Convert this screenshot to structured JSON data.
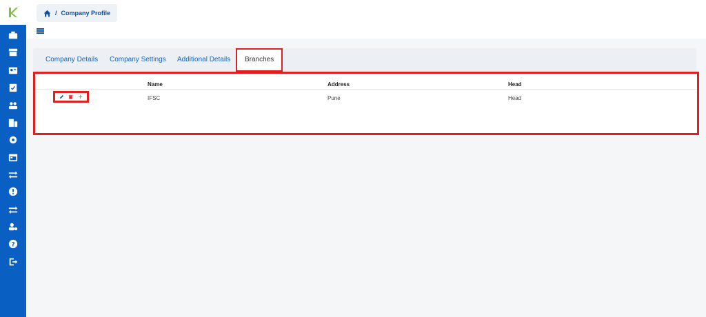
{
  "breadcrumb": {
    "separator": "/",
    "page": "Company Profile"
  },
  "tabs": [
    {
      "label": "Company Details"
    },
    {
      "label": "Company Settings"
    },
    {
      "label": "Additional Details"
    },
    {
      "label": "Branches",
      "active": true
    }
  ],
  "table": {
    "columns": [
      "Name",
      "Address",
      "Head"
    ],
    "rows": [
      {
        "name": "IFSC",
        "address": "Pune",
        "head": "Head"
      }
    ]
  },
  "sidebar": {
    "icons": [
      "briefcase-icon",
      "store-icon",
      "id-card-icon",
      "clipboard-check-icon",
      "people-icon",
      "buildings-icon",
      "gear-icon",
      "calendar-icon",
      "swap-icon",
      "alert-icon",
      "transfer-icon",
      "user-settings-icon",
      "help-icon",
      "logout-icon"
    ]
  },
  "colors": {
    "sidebar": "#0a5fc2",
    "accent": "#1565c0",
    "highlight": "#e02020",
    "logo": "#7cc242"
  }
}
